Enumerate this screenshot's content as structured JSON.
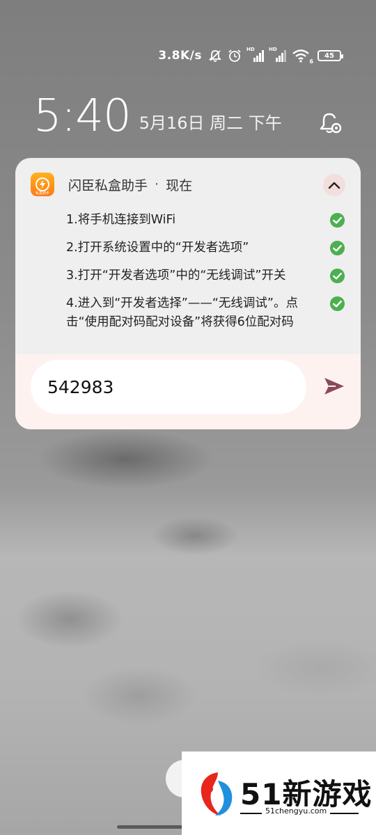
{
  "status_bar": {
    "net_speed": "3.8K/s",
    "battery": "45",
    "sim1_label": "HD",
    "sim2_label": "HD",
    "wifi_label": "6",
    "icons": [
      "mute-icon",
      "alarm-icon",
      "signal-icon",
      "signal-icon",
      "wifi-icon",
      "battery-icon"
    ]
  },
  "lockscreen": {
    "time": "5:40",
    "date": "5月16日 周二 下午"
  },
  "notification": {
    "app_name": "闪臣私盒助手",
    "separator": "·",
    "time": "现在",
    "app_icon_text": "私盒助手",
    "steps": [
      "1.将手机连接到WiFi",
      "2.打开系统设置中的“开发者选项”",
      "3.打开“开发者选项”中的“无线调试”开关",
      "4.进入到“开发者选择”——“无线调试”。点击“使用配对码配对设备”将获得6位配对码"
    ],
    "reply_value": "542983",
    "colors": {
      "check": "#4caf50",
      "send": "#8a4a5a",
      "reply_bg": "#fdf2f0"
    }
  },
  "watermark": {
    "title": "51新游戏",
    "url": "51chengyu.com"
  }
}
